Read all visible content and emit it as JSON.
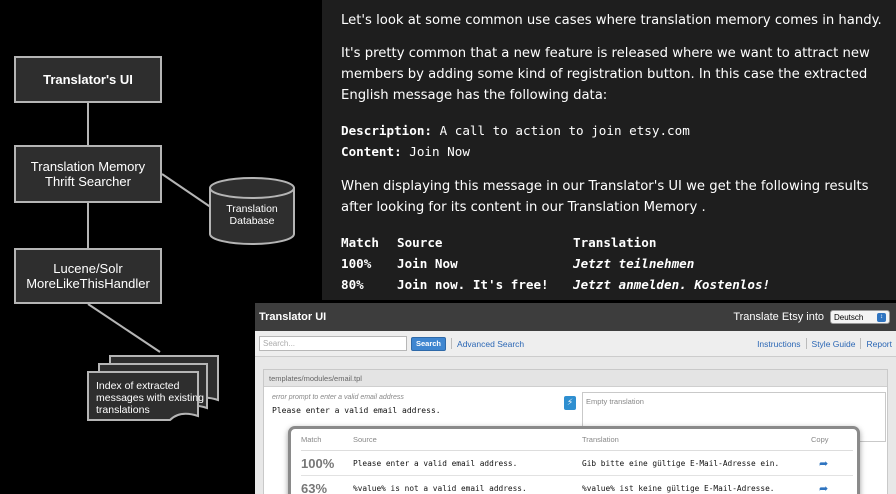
{
  "diagram": {
    "boxes": {
      "translators_ui": "Translator's UI",
      "tm_searcher": "Translation Memory Thrift Searcher",
      "lucene": "Lucene/Solr MoreLikeThisHandler"
    },
    "database_label": "Translation Database",
    "index_label": "Index of extracted messages with existing translations"
  },
  "article": {
    "para1": "Let's look at some common use cases where translation memory comes in handy.",
    "para2": "It's pretty common that a new feature is released where we want to attract new members by adding some kind of registration button. In this case the extracted English message has the following data:",
    "description_key": "Description:",
    "description_val": " A call to action to join etsy.com",
    "content_key": "Content:",
    "content_val": " Join Now",
    "para3": "When displaying this message in our Translator's UI we get the following results after looking for its content in our Translation Memory .",
    "table": {
      "headers": [
        "Match",
        "Source",
        "Translation"
      ],
      "rows": [
        [
          "100%",
          "Join Now",
          "Jetzt teilnehmen"
        ],
        [
          "80%",
          "Join now. It's free!",
          "Jetzt anmelden. Kostenlos!"
        ]
      ]
    }
  },
  "translator_ui": {
    "title": "Translator UI",
    "translate_into": "Translate Etsy into",
    "language": "Deutsch",
    "search_placeholder": "Search...",
    "search_button": "Search",
    "advanced_search": "Advanced Search",
    "links": [
      "Instructions",
      "Style Guide",
      "Report"
    ],
    "file_path": "templates/modules/email.tpl",
    "source_description": "error prompt to enter a valid email address",
    "source_text": "Please enter a valid email address.",
    "translation_placeholder": "Empty translation",
    "suggestions": {
      "headers": [
        "Match",
        "Source",
        "Translation",
        "Copy"
      ],
      "rows": [
        {
          "match": "100%",
          "source": "Please enter a valid email address.",
          "translation": "Gib bitte eine gültige E-Mail-Adresse ein."
        },
        {
          "match": "63%",
          "source": "%value% is not a valid email address.",
          "translation": "%value% ist keine gültige E-Mail-Adresse."
        }
      ]
    }
  }
}
